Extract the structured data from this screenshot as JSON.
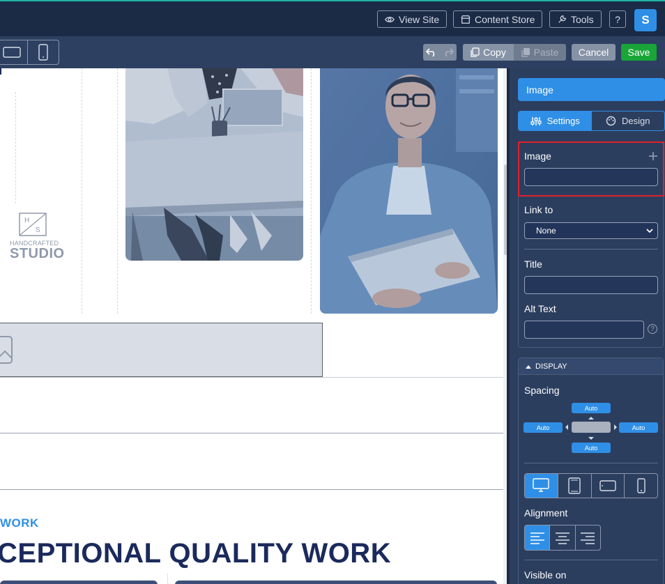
{
  "topbar": {
    "view_site": "View Site",
    "content_store": "Content Store",
    "tools": "Tools",
    "help": "?",
    "avatar_initial": "S"
  },
  "toolbar": {
    "copy": "Copy",
    "paste": "Paste",
    "cancel": "Cancel",
    "save": "Save"
  },
  "canvas": {
    "logo_hs_top": "H",
    "logo_hs_bottom": "S",
    "logo_small": "HANDCRAFTED",
    "logo_big": "STUDIO",
    "kicker": "WORK",
    "headline": "CEPTIONAL QUALITY WORK"
  },
  "panel": {
    "title": "Image",
    "tabs": [
      {
        "label": "Settings",
        "active": true
      },
      {
        "label": "Design",
        "active": false
      }
    ],
    "image_label": "Image",
    "image_value": "",
    "link_to_label": "Link to",
    "link_to_value": "None",
    "title_label": "Title",
    "title_value": "",
    "alt_text_label": "Alt Text",
    "alt_text_value": "",
    "help_glyph": "?",
    "display_header": "DISPLAY",
    "spacing_label": "Spacing",
    "spacing": {
      "top": "Auto",
      "left": "Auto",
      "right": "Auto",
      "bottom": "Auto"
    },
    "alignment_label": "Alignment",
    "visible_on_label": "Visible on"
  },
  "colors": {
    "accent": "#2f8fe6",
    "save": "#1aa538",
    "highlight": "#e0202a",
    "topbar": "#1b2a45",
    "panel": "#2c3e5e"
  }
}
